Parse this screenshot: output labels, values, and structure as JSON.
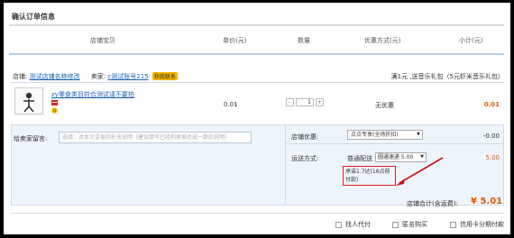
{
  "page": {
    "title": "确认订单信息"
  },
  "table_headers": {
    "shop_item": "店铺宝贝",
    "unit_price": "单价(元)",
    "quantity": "数量",
    "discount": "优惠方式(元)",
    "subtotal": "小计(元)"
  },
  "shop": {
    "label": "店铺:",
    "name": "测试店铺名称修改",
    "seller_label": "卖家:",
    "seller_name": "c测试账号215",
    "contact_label": "和我联系",
    "promo_text": "满1元 ,送音乐礼包（5元虾米音乐礼包）"
  },
  "item": {
    "title": "zy零食类目符合测试请不要拍",
    "unit_price": "0.01",
    "qty_minus": "-",
    "qty_value": "1",
    "qty_plus": "+",
    "discount_text": "无优惠",
    "subtotal": "0.01"
  },
  "message": {
    "label": "给卖家留言:",
    "placeholder": "选填：对本次交易的补充说明（建议填写已经和卖家达成一致的说明）"
  },
  "shop_discount": {
    "label": "店铺优惠:",
    "selected": "点点专享(全场折扣)",
    "amount": "-0.00"
  },
  "shipping": {
    "label": "运送方式:",
    "method": "普通配送",
    "selected": "圆通速递  5.00",
    "amount": "5.00",
    "note": "承诺1.7达(16点前付款)"
  },
  "total": {
    "label": "店铺合计(含运费):",
    "amount": "¥ 5.01"
  },
  "options": [
    {
      "label": "找人代付"
    },
    {
      "label": "匿名购买"
    },
    {
      "label": "信用卡分期付款"
    }
  ],
  "colors": {
    "accent": "#e05a00",
    "link": "#1a5fb4",
    "panel": "#eef4fb",
    "annotation": "#e02020"
  }
}
